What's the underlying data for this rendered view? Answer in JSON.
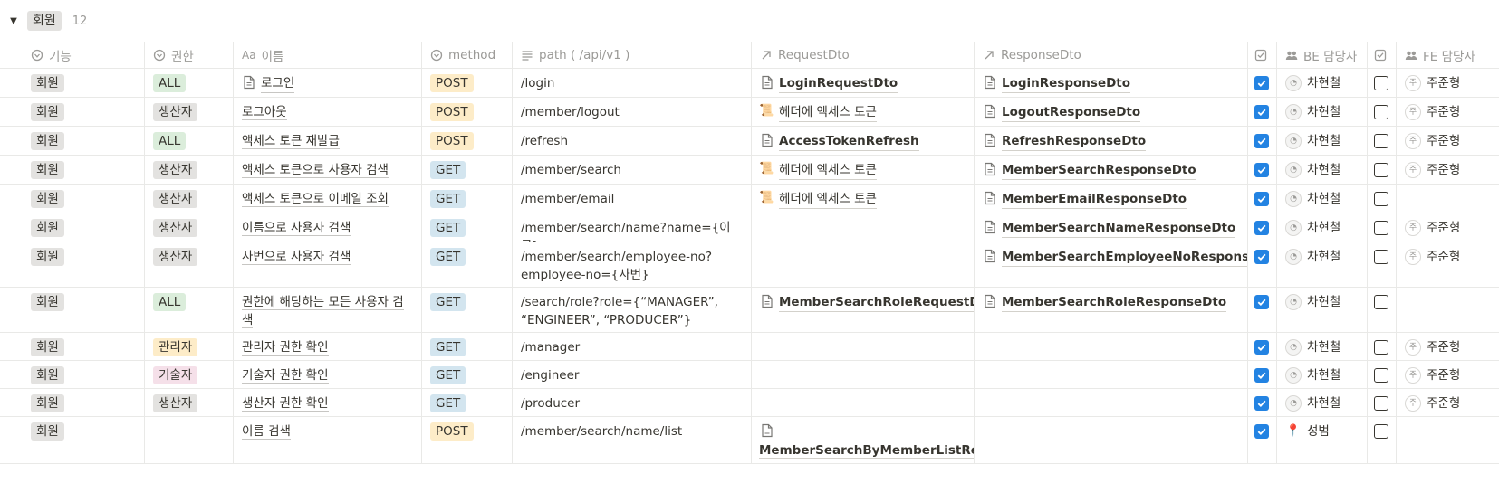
{
  "group": {
    "toggle": "▼",
    "label": "회원",
    "count": "12"
  },
  "columns": {
    "func": "기능",
    "perm": "권한",
    "name": "이름",
    "name_prefix": "Aa",
    "method": "method",
    "path": "path ( /api/v1 )",
    "req": "RequestDto",
    "res": "ResponseDto",
    "be": "BE 담당자",
    "fe": "FE 담당자"
  },
  "colors": {
    "tag_gray": "#e3e2e0",
    "tag_green": "#dbeddb",
    "tag_orange": "#fdecc8",
    "tag_blue": "#d3e5ef",
    "tag_pink": "#f5e0e9",
    "tag_yellow": "#fdecc8",
    "checkbox_blue": "#2383e2"
  },
  "rows": [
    {
      "func": "회원",
      "perm": "ALL",
      "perm_color": "#dbeddb",
      "name": "로그인",
      "name_icon": "doc-icon",
      "method": "POST",
      "method_color": "#fdecc8",
      "path": "/login",
      "req": "LoginRequestDto",
      "req_icon": "doc-icon",
      "res": "LoginResponseDto",
      "be_checked": true,
      "be": "차현철",
      "fe_checked": false,
      "fe": "주준형"
    },
    {
      "func": "회원",
      "perm": "생산자",
      "perm_color": "#e3e2e0",
      "name": "로그아웃",
      "method": "POST",
      "method_color": "#fdecc8",
      "path": "/member/logout",
      "req": "헤더에 엑세스 토큰",
      "req_icon": "scroll-icon",
      "res": "LogoutResponseDto",
      "be_checked": true,
      "be": "차현철",
      "fe_checked": false,
      "fe": "주준형"
    },
    {
      "func": "회원",
      "perm": "ALL",
      "perm_color": "#dbeddb",
      "name": "액세스 토큰 재발급",
      "method": "POST",
      "method_color": "#fdecc8",
      "path": "/refresh",
      "req": "AccessTokenRefresh",
      "req_icon": "doc-icon",
      "res": "RefreshResponseDto",
      "be_checked": true,
      "be": "차현철",
      "fe_checked": false,
      "fe": "주준형"
    },
    {
      "func": "회원",
      "perm": "생산자",
      "perm_color": "#e3e2e0",
      "name": "액세스 토큰으로 사용자 검색",
      "method": "GET",
      "method_color": "#d3e5ef",
      "path": "/member/search",
      "req": "헤더에 엑세스 토큰",
      "req_icon": "scroll-icon",
      "res": "MemberSearchResponseDto",
      "be_checked": true,
      "be": "차현철",
      "fe_checked": false,
      "fe": "주준형"
    },
    {
      "func": "회원",
      "perm": "생산자",
      "perm_color": "#e3e2e0",
      "name": "액세스 토큰으로 이메일 조회",
      "method": "GET",
      "method_color": "#d3e5ef",
      "path": "/member/email",
      "req": "헤더에 엑세스 토큰",
      "req_icon": "scroll-icon",
      "res": "MemberEmailResponseDto",
      "be_checked": true,
      "be": "차현철",
      "fe_checked": false,
      "fe": ""
    },
    {
      "func": "회원",
      "perm": "생산자",
      "perm_color": "#e3e2e0",
      "name": "이름으로 사용자 검색",
      "method": "GET",
      "method_color": "#d3e5ef",
      "path": "/member/search/name?name={이름}",
      "req": "",
      "res": "MemberSearchNameResponseDto",
      "be_checked": true,
      "be": "차현철",
      "fe_checked": false,
      "fe": "주준형"
    },
    {
      "func": "회원",
      "perm": "생산자",
      "perm_color": "#e3e2e0",
      "name": "사번으로 사용자 검색",
      "method": "GET",
      "method_color": "#d3e5ef",
      "path": "/member/search/employee-no?employee-no={사번}",
      "req": "",
      "res": "MemberSearchEmployeeNoResponseDto",
      "be_checked": true,
      "be": "차현철",
      "fe_checked": false,
      "fe": "주준형"
    },
    {
      "func": "회원",
      "perm": "ALL",
      "perm_color": "#dbeddb",
      "name": "권한에 해당하는 모든 사용자 검색",
      "method": "GET",
      "method_color": "#d3e5ef",
      "path": "/search/role?role={“MANAGER”, “ENGINEER”, “PRODUCER”}",
      "req": "MemberSearchRoleRequestDto",
      "req_icon": "doc-icon",
      "res": "MemberSearchRoleResponseDto",
      "be_checked": true,
      "be": "차현철",
      "fe_checked": false,
      "fe": ""
    },
    {
      "func": "회원",
      "perm": "관리자",
      "perm_color": "#fdecc8",
      "name": "관리자 권한 확인",
      "method": "GET",
      "method_color": "#d3e5ef",
      "path": "/manager",
      "req": "",
      "res": "",
      "be_checked": true,
      "be": "차현철",
      "fe_checked": false,
      "fe": "주준형"
    },
    {
      "func": "회원",
      "perm": "기술자",
      "perm_color": "#f5e0e9",
      "name": "기술자 권한 확인",
      "method": "GET",
      "method_color": "#d3e5ef",
      "path": "/engineer",
      "req": "",
      "res": "",
      "be_checked": true,
      "be": "차현철",
      "fe_checked": false,
      "fe": "주준형"
    },
    {
      "func": "회원",
      "perm": "생산자",
      "perm_color": "#e3e2e0",
      "name": "생산자 권한 확인",
      "method": "GET",
      "method_color": "#d3e5ef",
      "path": "/producer",
      "req": "",
      "res": "",
      "be_checked": true,
      "be": "차현철",
      "fe_checked": false,
      "fe": "주준형"
    },
    {
      "func": "회원",
      "perm": "",
      "perm_color": "",
      "name": "이름 검색",
      "method": "POST",
      "method_color": "#fdecc8",
      "path": "/member/search/name/list",
      "req": "MemberSearchByMemberListRequest",
      "req_icon": "doc-icon",
      "res": "",
      "be_checked": true,
      "be": "성범",
      "be_avatar": "pin",
      "fe_checked": false,
      "fe": ""
    }
  ]
}
